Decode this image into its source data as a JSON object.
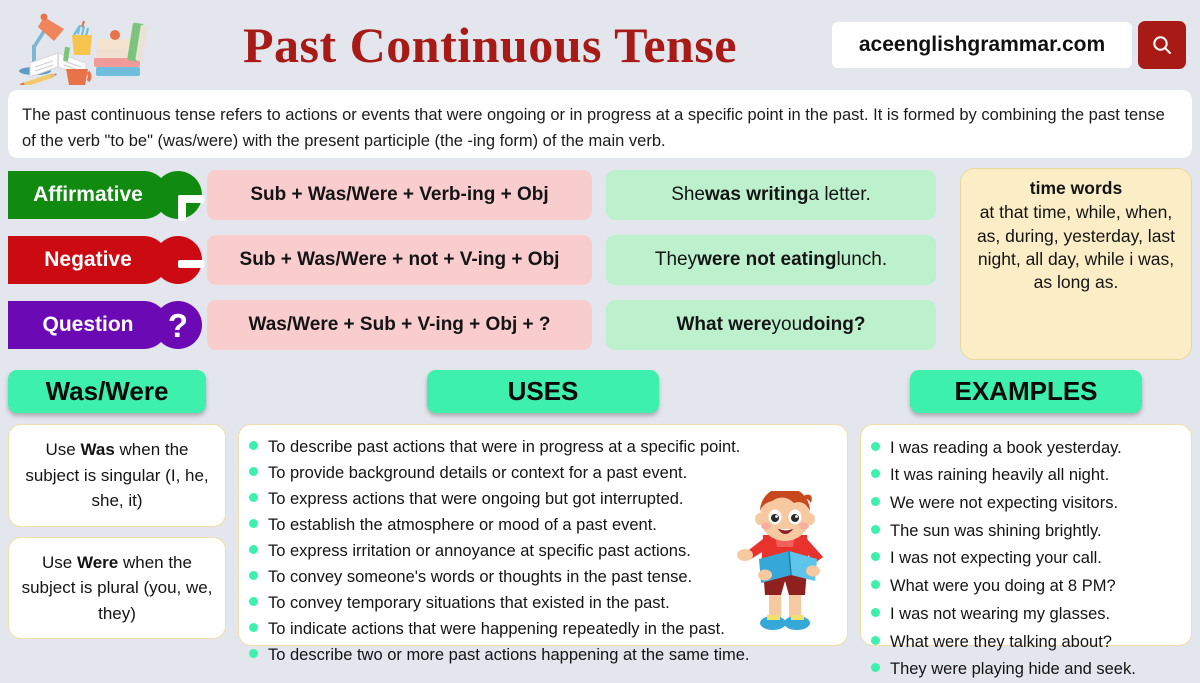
{
  "header": {
    "title": "Past Continuous Tense",
    "title_color": "#a81a16",
    "search_value": "aceenglishgrammar.com",
    "search_placeholder": "aceenglishgrammar.com",
    "search_icon": "search-icon",
    "search_button_color": "#a81a16",
    "desk_illustration": "study-desk-illustration"
  },
  "description": "The past continuous tense refers to actions or events that were ongoing or in progress at a specific point in the past. It is formed by combining the past tense of the verb \"to be\" (was/were) with the present participle (the -ing form) of the main verb.",
  "formulas": [
    {
      "label": "Affirmative",
      "color": "#118a10",
      "badge": "plus-icon",
      "structure": "Sub + Was/Were + Verb-ing + Obj",
      "example_parts": [
        {
          "text": "She ",
          "bold": false
        },
        {
          "text": "was writing",
          "bold": true
        },
        {
          "text": " a letter.",
          "bold": false
        }
      ]
    },
    {
      "label": "Negative",
      "color": "#cc0a12",
      "badge": "minus-icon",
      "structure": "Sub + Was/Were + not + V-ing + Obj",
      "example_parts": [
        {
          "text": "They ",
          "bold": false
        },
        {
          "text": "were not eating",
          "bold": true
        },
        {
          "text": " lunch.",
          "bold": false
        }
      ]
    },
    {
      "label": "Question",
      "color": "#6b09b5",
      "badge": "question-mark-icon",
      "structure": "Was/Were + Sub + V-ing + Obj + ?",
      "example_parts": [
        {
          "text": "What were",
          "bold": true
        },
        {
          "text": " you ",
          "bold": false
        },
        {
          "text": "doing?",
          "bold": true
        }
      ]
    }
  ],
  "time_words": {
    "title": "time words",
    "body": "at that time, while, when, as, during, yesterday, last night, all day, while i was, as long as."
  },
  "was_were": {
    "heading": "Was/Were",
    "cards": [
      {
        "parts": [
          {
            "text": "Use ",
            "bold": false
          },
          {
            "text": "Was",
            "bold": true
          },
          {
            "text": " when the subject is singular (I, he, she, it)",
            "bold": false
          }
        ]
      },
      {
        "parts": [
          {
            "text": "Use ",
            "bold": false
          },
          {
            "text": "Were",
            "bold": true
          },
          {
            "text": " when the subject is plural (you, we, they)",
            "bold": false
          }
        ]
      }
    ]
  },
  "uses": {
    "heading": "USES",
    "items": [
      "To describe past actions that were in progress at a specific point.",
      "To provide background details or context for a past event.",
      "To express actions that were ongoing but got interrupted.",
      "To establish the atmosphere or mood of a past event.",
      "To express irritation or annoyance at specific past actions.",
      "To convey someone's words or thoughts in the past tense.",
      "To convey temporary situations that existed in the past.",
      "To indicate actions that were happening repeatedly in the past.",
      "To describe two or more past actions happening at the same time."
    ],
    "character": "boy-with-book-illustration"
  },
  "examples": {
    "heading": "EXAMPLES",
    "items": [
      "I was reading a book yesterday.",
      "It was raining heavily all night.",
      "We were not expecting visitors.",
      "The sun was shining brightly.",
      "I was not expecting your call.",
      "What were you doing at 8 PM?",
      "I was not wearing my glasses.",
      "What were they talking about?",
      "They were playing hide and seek."
    ]
  },
  "colors": {
    "page_background": "#e3e6ed",
    "mint": "#3df0ae",
    "pink": "#f9cdcd",
    "green_example": "#bdf0cd",
    "cream": "#fbeec6"
  }
}
